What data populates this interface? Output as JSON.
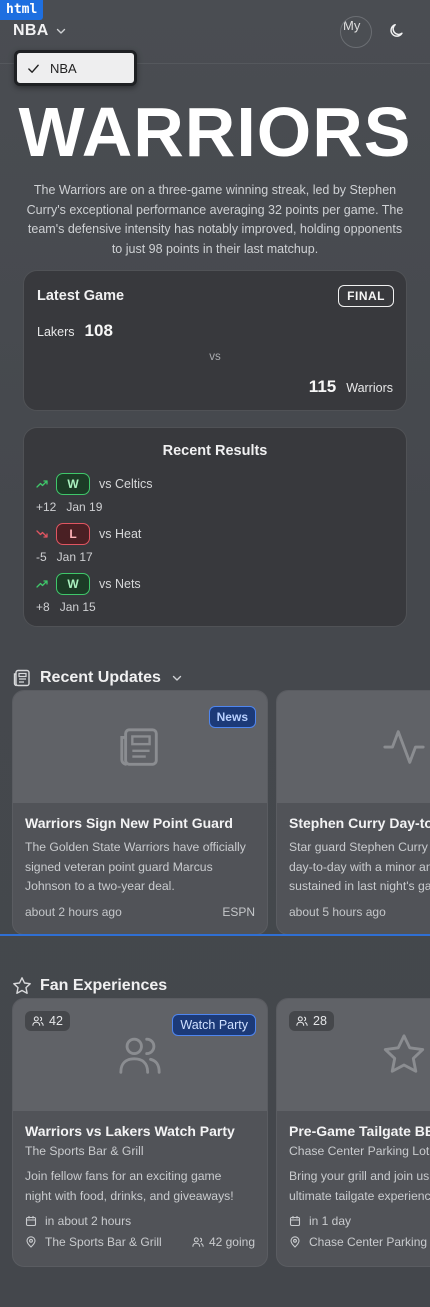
{
  "dev_tag": "html",
  "header": {
    "league": "NBA",
    "avatar_alt": "My",
    "dropdown": {
      "selected": "NBA"
    }
  },
  "hero": {
    "title": "WARRIORS",
    "description": "The Warriors are on a three-game winning streak, led by Stephen Curry's exceptional performance averaging 32 points per game. The team's defensive intensity has notably improved, holding opponents to just 98 points in their last matchup."
  },
  "latest_game": {
    "title": "Latest Game",
    "status": "FINAL",
    "away": {
      "team": "Lakers",
      "score": "108"
    },
    "vs": "vs",
    "home": {
      "team": "Warriors",
      "score": "115"
    }
  },
  "recent_results": {
    "title": "Recent Results",
    "items": [
      {
        "result": "W",
        "opponent": "vs Celtics",
        "margin": "+12",
        "date": "Jan 19",
        "trend": "up"
      },
      {
        "result": "L",
        "opponent": "vs Heat",
        "margin": "-5",
        "date": "Jan 17",
        "trend": "down"
      },
      {
        "result": "W",
        "opponent": "vs Nets",
        "margin": "+8",
        "date": "Jan 15",
        "trend": "up"
      }
    ]
  },
  "updates": {
    "title": "Recent Updates",
    "cards": [
      {
        "tag": "News",
        "icon": "newspaper-icon",
        "title": "Warriors Sign New Point Guard",
        "desc_lines": [
          "The Golden State Warriors have officially",
          "signed veteran point guard Marcus",
          "Johnson to a two-year deal."
        ],
        "time": "about 2 hours ago",
        "source": "ESPN"
      },
      {
        "tag": "",
        "icon": "activity-icon",
        "title": "Stephen Curry Day-to-Day",
        "desc_lines": [
          "Star guard Stephen Curry is",
          "day-to-day with a minor ankle",
          "sustained in last night's game"
        ],
        "time": "about 5 hours ago",
        "source": ""
      }
    ]
  },
  "fan": {
    "title": "Fan Experiences",
    "cards": [
      {
        "going_count": "42",
        "tag": "Watch Party",
        "icon": "users-icon",
        "title": "Warriors vs Lakers Watch Party",
        "venue": "The Sports Bar & Grill",
        "desc_lines": [
          "Join fellow fans for an exciting game",
          "night with food, drinks, and giveaways!"
        ],
        "when": "in about 2 hours",
        "location": "The Sports Bar & Grill",
        "going": "42 going"
      },
      {
        "going_count": "28",
        "tag": "",
        "icon": "star-icon",
        "title": "Pre-Game Tailgate BBQ",
        "venue": "Chase Center Parking Lot",
        "desc_lines": [
          "Bring your grill and join us for the",
          "ultimate tailgate experience!"
        ],
        "when": "in 1 day",
        "location": "Chase Center Parking",
        "going": ""
      }
    ]
  },
  "colors": {
    "win": "#3fc76a",
    "loss": "#e05561",
    "accent_blue": "#4f86f0"
  }
}
